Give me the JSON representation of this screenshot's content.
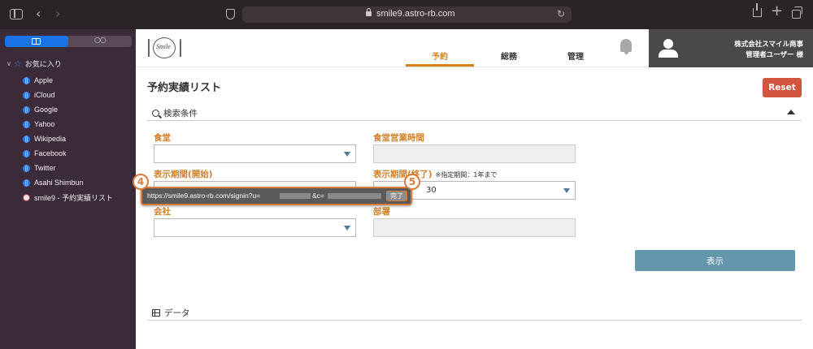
{
  "browser": {
    "url": "smile9.astro-rb.com",
    "icons": [
      "sidebar-icon",
      "back-icon",
      "forward-icon",
      "shield-icon",
      "lock-icon",
      "reload-icon",
      "share-icon",
      "plus-icon",
      "tabs-icon"
    ]
  },
  "sidebar": {
    "favorites_label": "お気に入り",
    "items": [
      {
        "label": "Apple"
      },
      {
        "label": "iCloud"
      },
      {
        "label": "Google"
      },
      {
        "label": "Yahoo"
      },
      {
        "label": "Wikipedia"
      },
      {
        "label": "Facebook"
      },
      {
        "label": "Twitter"
      },
      {
        "label": "Asahi Shimbun"
      },
      {
        "label": "smile9 - 予約実績リスト"
      }
    ]
  },
  "header": {
    "logo_text": "Smile",
    "nav": [
      {
        "label": "予約"
      },
      {
        "label": "総務"
      },
      {
        "label": "管理"
      }
    ],
    "active_tab": "予約",
    "company": "株式会社スマイル商事",
    "user": "管理者ユーザー 様"
  },
  "page": {
    "title": "予約実績リスト",
    "reset_label": "Reset",
    "search_section": "検索条件",
    "fields": {
      "cafeteria": "食堂",
      "hours": "食堂営業時間",
      "period_start": "表示期間(開始)",
      "period_end": "表示期間(終了)",
      "period_note": "※指定期間：1年まで",
      "period_end_value": "30",
      "company": "会社",
      "department": "部署"
    },
    "show_label": "表示",
    "data_section": "データ"
  },
  "popup": {
    "url_prefix": "https://smile9.astro-rb.com/signin?u=",
    "url_mid": "&c=",
    "done_label": "完了",
    "callout_url": "4",
    "callout_done": "5"
  },
  "colors": {
    "accent_orange": "#d8821e",
    "reset_red": "#d2543f",
    "show_blue": "#6496ac",
    "safari_sidebar": "#3b2a38",
    "callout": "#d97b3a"
  }
}
